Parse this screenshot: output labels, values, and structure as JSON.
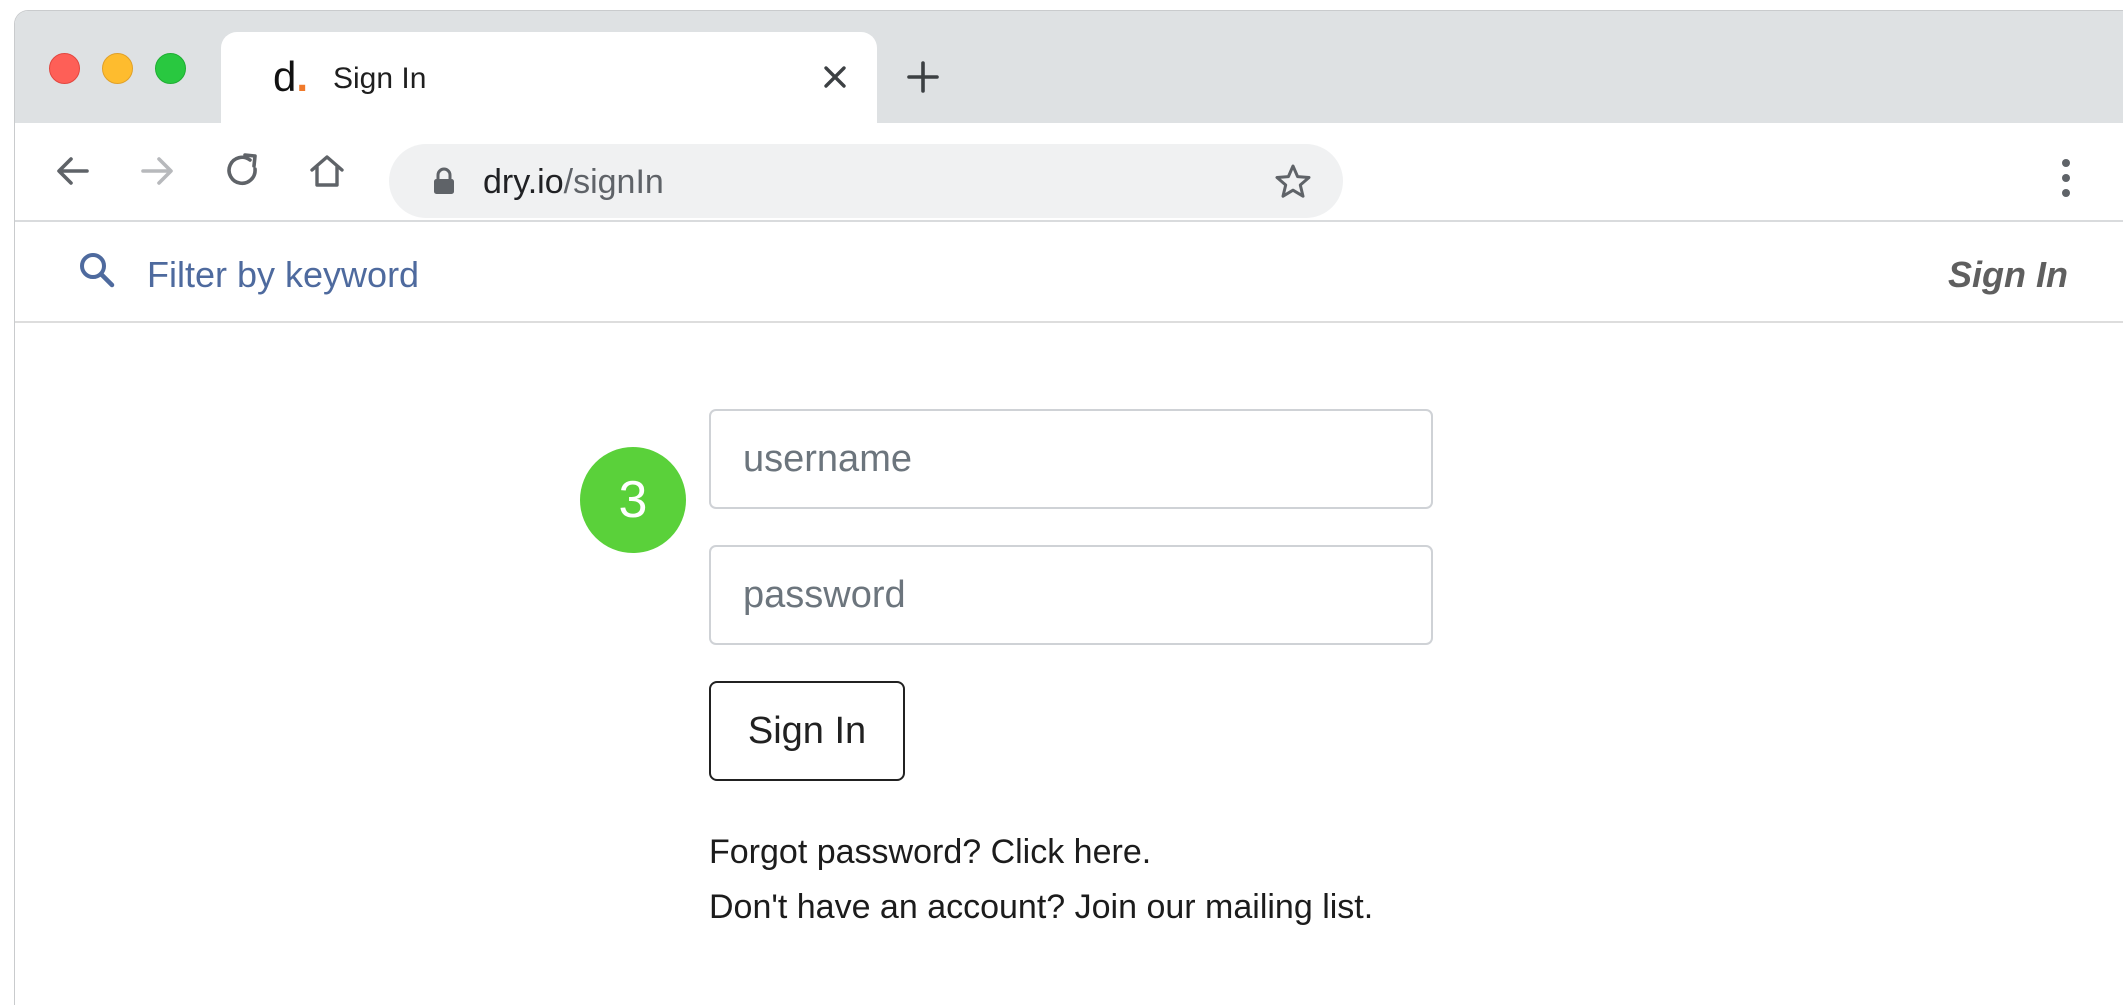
{
  "browser": {
    "tab": {
      "favicon_letter": "d",
      "favicon_dot": ".",
      "title": "Sign In"
    },
    "url": {
      "domain": "dry.io",
      "path": "/signIn"
    }
  },
  "site_header": {
    "search_label": "Filter by keyword",
    "signin_link": "Sign In"
  },
  "form": {
    "step_number": "3",
    "username_placeholder": "username",
    "password_placeholder": "password",
    "submit_label": "Sign In",
    "forgot_text": "Forgot password? Click here.",
    "signup_text": "Don't have an account? Join our mailing list."
  },
  "colors": {
    "step_badge": "#5ad13a",
    "filter_text": "#4e6a9e",
    "favicon_dot": "#f07a2b"
  },
  "icons": [
    "close-icon",
    "plus-icon",
    "back-arrow-icon",
    "forward-arrow-icon",
    "reload-icon",
    "home-icon",
    "lock-icon",
    "star-icon",
    "more-menu-icon",
    "search-icon"
  ]
}
